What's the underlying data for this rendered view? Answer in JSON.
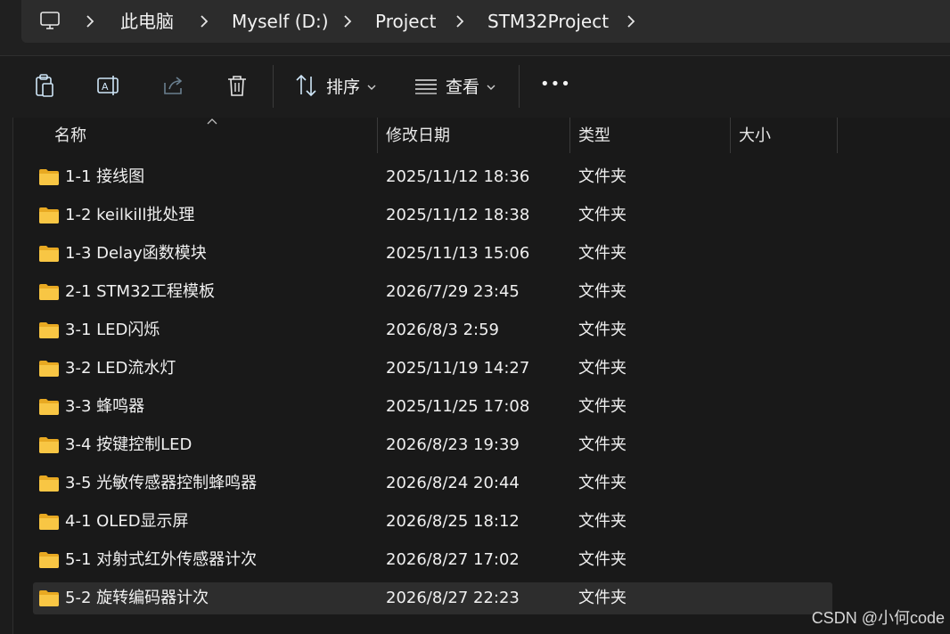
{
  "address_bar": {
    "crumbs": [
      "此电脑",
      "Myself (D:)",
      "Project",
      "STM32Project"
    ]
  },
  "toolbar": {
    "sort_label": "排序",
    "view_label": "查看",
    "more_label": "•••"
  },
  "columns": {
    "name": "名称",
    "modified": "修改日期",
    "type": "类型",
    "size": "大小"
  },
  "rows": [
    {
      "name": "1-1 接线图",
      "modified": "2025/11/12 18:36",
      "type": "文件夹"
    },
    {
      "name": "1-2 keilkill批处理",
      "modified": "2025/11/12 18:38",
      "type": "文件夹"
    },
    {
      "name": "1-3 Delay函数模块",
      "modified": "2025/11/13 15:06",
      "type": "文件夹"
    },
    {
      "name": "2-1 STM32工程模板",
      "modified": "2026/7/29 23:45",
      "type": "文件夹"
    },
    {
      "name": "3-1 LED闪烁",
      "modified": "2026/8/3 2:59",
      "type": "文件夹"
    },
    {
      "name": "3-2 LED流水灯",
      "modified": "2025/11/19 14:27",
      "type": "文件夹"
    },
    {
      "name": "3-3 蜂鸣器",
      "modified": "2025/11/25 17:08",
      "type": "文件夹"
    },
    {
      "name": "3-4 按键控制LED",
      "modified": "2026/8/23 19:39",
      "type": "文件夹"
    },
    {
      "name": "3-5 光敏传感器控制蜂鸣器",
      "modified": "2026/8/24 20:44",
      "type": "文件夹"
    },
    {
      "name": "4-1 OLED显示屏",
      "modified": "2026/8/25 18:12",
      "type": "文件夹"
    },
    {
      "name": "5-1 对射式红外传感器计次",
      "modified": "2026/8/27 17:02",
      "type": "文件夹"
    },
    {
      "name": "5-2 旋转编码器计次",
      "modified": "2026/8/27 22:23",
      "type": "文件夹"
    }
  ],
  "watermark": "CSDN @小何code",
  "colors": {
    "folder": "#f8c644",
    "folder_dark": "#e8a922",
    "accent": "#76b9ed"
  }
}
